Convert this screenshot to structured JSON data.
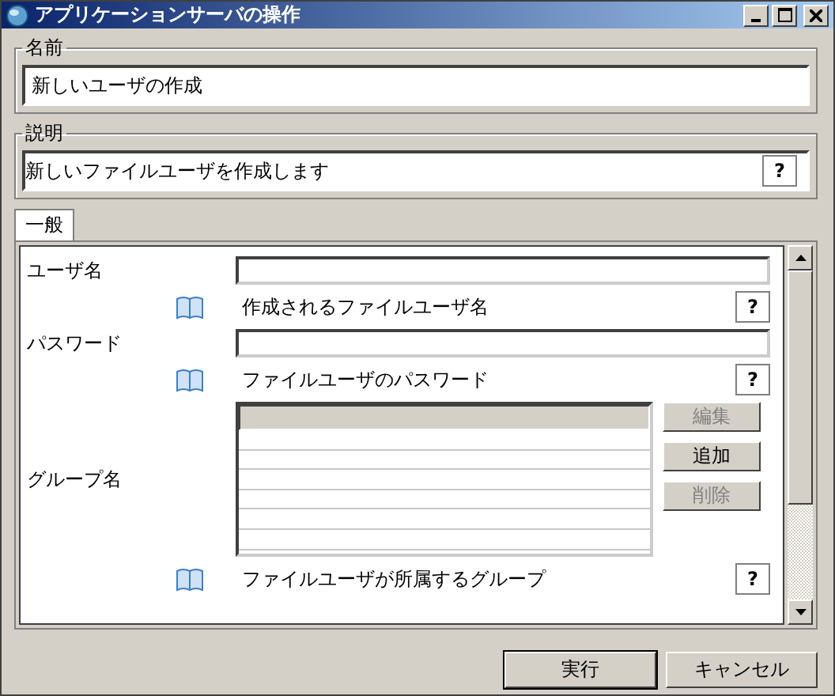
{
  "window": {
    "title": "アプリケーションサーバの操作"
  },
  "name_group": {
    "label": "名前",
    "value": "新しいユーザの作成"
  },
  "description_group": {
    "label": "説明",
    "value": "新しいファイルユーザを作成します",
    "help": "?"
  },
  "tabs": [
    {
      "label": "一般",
      "selected": true
    }
  ],
  "fields": [
    {
      "kind": "text",
      "label": "ユーザ名",
      "hint": "作成されるファイルユーザ名",
      "help": "?"
    },
    {
      "kind": "text",
      "label": "パスワード",
      "hint": "ファイルユーザのパスワード",
      "help": "?"
    },
    {
      "kind": "list",
      "label": "グループ名",
      "hint": "ファイルユーザが所属するグループ",
      "help": "?",
      "buttons": [
        {
          "label": "編集",
          "disabled": true
        },
        {
          "label": "追加",
          "disabled": false
        },
        {
          "label": "削除",
          "disabled": true
        }
      ]
    }
  ],
  "buttons": [
    {
      "label": "実行",
      "default": true
    },
    {
      "label": "キャンセル",
      "default": false
    }
  ]
}
